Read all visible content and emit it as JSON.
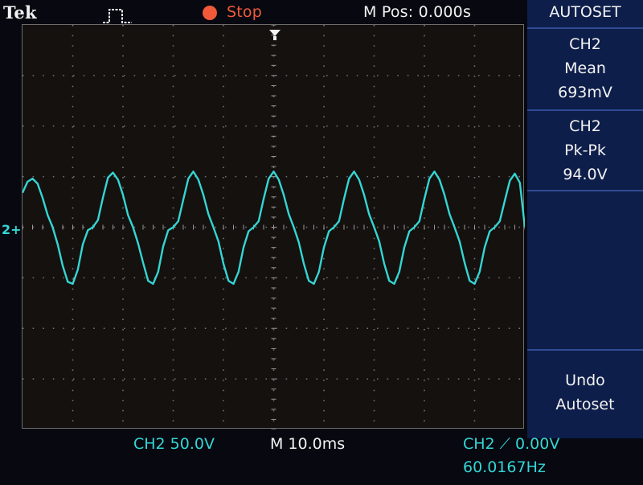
{
  "header": {
    "brand": "Tek",
    "trigger_mode_icon": "pulse-trigger-icon",
    "run_state": "Stop",
    "horizontal_position": "M Pos: 0.000s"
  },
  "side_menu": {
    "title": "AUTOSET",
    "boxes": [
      {
        "lines": [
          "CH2",
          "Mean",
          "693mV"
        ]
      },
      {
        "lines": [
          "CH2",
          "Pk-Pk",
          "94.0V"
        ]
      },
      {
        "lines": []
      },
      {
        "lines": [
          "Undo",
          "Autoset"
        ]
      }
    ]
  },
  "status": {
    "channel_scale": "CH2  50.0V",
    "timebase": "M 10.0ms",
    "trigger": "CH2 ⟋ 0.00V",
    "frequency": "60.0167Hz"
  },
  "channel_marker": "2+",
  "colors": {
    "trace": "#34d6d4",
    "stop": "#f05a3a",
    "menu_bg": "#0e1e4a"
  },
  "chart_data": {
    "type": "line",
    "title": "",
    "xlabel": "",
    "ylabel": "",
    "x_unit_per_div": "10.0ms",
    "y_unit_per_div": "50.0V",
    "xlim": [
      -50,
      50
    ],
    "ylim": [
      -200,
      200
    ],
    "series": [
      {
        "x": [
          -50,
          -49,
          -48,
          -47,
          -46,
          -45,
          -44,
          -43,
          -42,
          -41,
          -40,
          -39,
          -38,
          -37,
          -36,
          -35,
          -34,
          -33,
          -32,
          -31,
          -30,
          -29,
          -28,
          -27,
          -26,
          -25,
          -24,
          -23,
          -22,
          -21,
          -20,
          -19,
          -18,
          -17,
          -16,
          -15,
          -14,
          -13,
          -12,
          -11,
          -10,
          -9,
          -8,
          -7,
          -6,
          -5,
          -4,
          -3,
          -2,
          -1,
          0,
          1,
          2,
          3,
          4,
          5,
          6,
          7,
          8,
          9,
          10,
          11,
          12,
          13,
          14,
          15,
          16,
          17,
          18,
          19,
          20,
          21,
          22,
          23,
          24,
          25,
          26,
          27,
          28,
          29,
          30,
          31,
          32,
          33,
          34,
          35,
          36,
          37,
          38,
          39,
          40,
          41,
          42,
          43,
          44,
          45,
          46,
          47,
          48,
          49,
          50
        ],
        "y": [
          34,
          45,
          48,
          43,
          29,
          12,
          0,
          -17,
          -38,
          -54,
          -56,
          -42,
          -17,
          -3,
          0,
          7,
          29,
          49,
          54,
          47,
          32,
          12,
          0,
          -16,
          -35,
          -53,
          -56,
          -44,
          -19,
          -3,
          0,
          6,
          27,
          48,
          55,
          47,
          32,
          13,
          0,
          -14,
          -36,
          -53,
          -56,
          -44,
          -20,
          -4,
          0,
          6,
          28,
          48,
          55,
          47,
          32,
          13,
          0,
          -15,
          -36,
          -53,
          -56,
          -44,
          -20,
          -4,
          0,
          6,
          28,
          48,
          55,
          47,
          32,
          13,
          0,
          -14,
          -36,
          -53,
          -56,
          -44,
          -20,
          -4,
          0,
          6,
          28,
          48,
          55,
          47,
          32,
          13,
          0,
          -14,
          -35,
          -53,
          -56,
          -44,
          -20,
          -4,
          0,
          6,
          26,
          46,
          53,
          44,
          0
        ]
      }
    ]
  }
}
